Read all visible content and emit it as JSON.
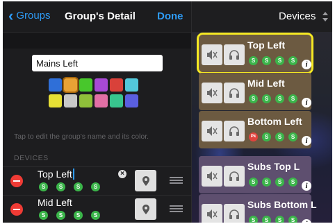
{
  "nav": {
    "back_label": "Groups",
    "title": "Group's Detail",
    "done_label": "Done"
  },
  "group": {
    "name_value": "Mains Left"
  },
  "palette": {
    "colors": [
      "#2f6fd8",
      "#e8a235",
      "#48c72c",
      "#a849d4",
      "#d9413a",
      "#53c8da",
      "#e6df35",
      "#c8c8c8",
      "#8fc03a",
      "#e26fa5",
      "#38c58e",
      "#5a5fe0"
    ],
    "selected_index": 1,
    "selected_outline": "#a5650c"
  },
  "hint_text": "Tap to edit the group's name and its color.",
  "devices_section": {
    "header": "DEVICES",
    "rows": [
      {
        "name": "Top Left",
        "badges": [
          "S",
          "S",
          "S",
          "S"
        ],
        "editing": true
      },
      {
        "name": "Mid Left",
        "badges": [
          "S",
          "S",
          "S",
          "S"
        ],
        "editing": false
      }
    ]
  },
  "right_panel": {
    "title": "Devices",
    "cards": [
      {
        "name": "Top Left",
        "badges": [
          "S",
          "S",
          "S",
          "S"
        ],
        "color": "brown",
        "selected": true
      },
      {
        "name": "Mid Left",
        "badges": [
          "S",
          "S",
          "S",
          "S"
        ],
        "color": "brown",
        "selected": false
      },
      {
        "name": "Bottom Left",
        "badges": [
          "Pk",
          "S",
          "S",
          "S"
        ],
        "color": "brown",
        "selected": false
      },
      {
        "name": "Subs Top L",
        "badges": [
          "S",
          "S",
          "S",
          "S"
        ],
        "color": "purple",
        "selected": false
      },
      {
        "name": "Subs Bottom L",
        "badges": [
          "S",
          "S",
          "S",
          "S"
        ],
        "color": "purple",
        "selected": false
      }
    ],
    "info_glyph": "i"
  },
  "icons": {
    "back": "chevron-left-icon",
    "clear": "clear-text-icon",
    "location": "location-pin-icon",
    "reorder": "reorder-handle-icon",
    "mute": "speaker-mute-icon",
    "headphones": "headphones-icon",
    "info": "info-icon",
    "sort": "sort-updown-icon"
  },
  "colors": {
    "accent": "#2e9bf5",
    "remove": "#ef3b35",
    "badge_green": "#3bb54a",
    "badge_pk": "#e0433d",
    "selection": "#f5e823",
    "card_brown": "#6c5a41",
    "card_purple": "#5e4f6f"
  }
}
